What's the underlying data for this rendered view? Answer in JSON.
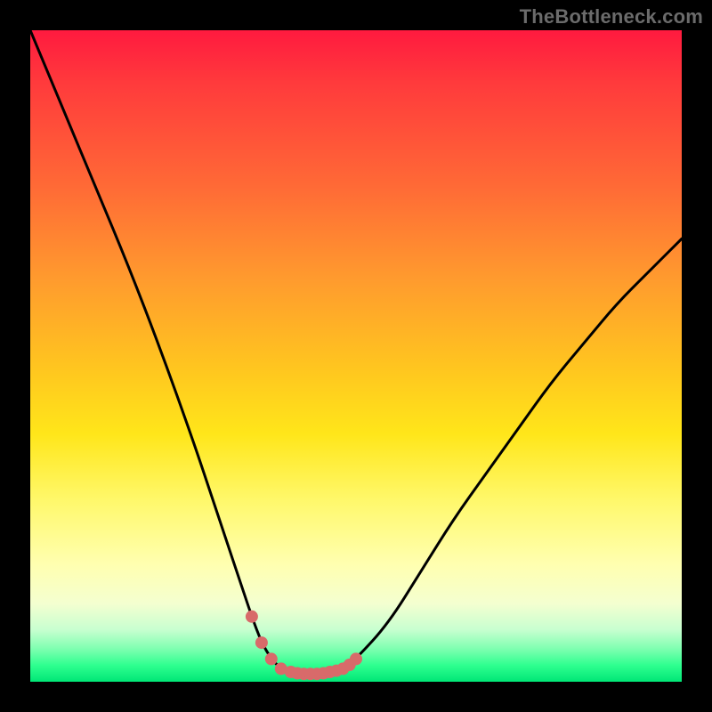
{
  "watermark": "TheBottleneck.com",
  "chart_data": {
    "type": "line",
    "title": "",
    "xlabel": "",
    "ylabel": "",
    "xlim": [
      0,
      100
    ],
    "ylim": [
      0,
      100
    ],
    "background_gradient": {
      "top": "#ff1a3f",
      "bottom": "#00e676",
      "stops": [
        {
          "pos": 0,
          "color": "#ff1a3f"
        },
        {
          "pos": 24,
          "color": "#ff6a36"
        },
        {
          "pos": 52,
          "color": "#ffc61f"
        },
        {
          "pos": 72,
          "color": "#fff86a"
        },
        {
          "pos": 92,
          "color": "#c8ffd0"
        },
        {
          "pos": 100,
          "color": "#00e676"
        }
      ]
    },
    "series": [
      {
        "name": "bottleneck-curve",
        "color": "#000000",
        "x": [
          0,
          5,
          10,
          15,
          20,
          25,
          28,
          30,
          32,
          34,
          35.5,
          37,
          38.5,
          40,
          42,
          44,
          46,
          48,
          50,
          55,
          60,
          65,
          70,
          75,
          80,
          85,
          90,
          95,
          100
        ],
        "y": [
          100,
          88,
          76,
          64,
          51,
          37,
          28,
          22,
          16,
          10,
          6,
          3.5,
          2,
          1.5,
          1.2,
          1.2,
          1.5,
          2,
          3.5,
          9,
          17,
          25,
          32,
          39,
          46,
          52,
          58,
          63,
          68
        ]
      }
    ],
    "markers": {
      "name": "trough-markers",
      "color": "#d86a6a",
      "radius_px": 7,
      "x": [
        34,
        35.5,
        37,
        38.5,
        40,
        41,
        42,
        43,
        44,
        45,
        46,
        47,
        48,
        49,
        50
      ],
      "y": [
        10,
        6,
        3.5,
        2,
        1.5,
        1.3,
        1.2,
        1.2,
        1.2,
        1.3,
        1.5,
        1.7,
        2,
        2.6,
        3.5
      ]
    }
  }
}
